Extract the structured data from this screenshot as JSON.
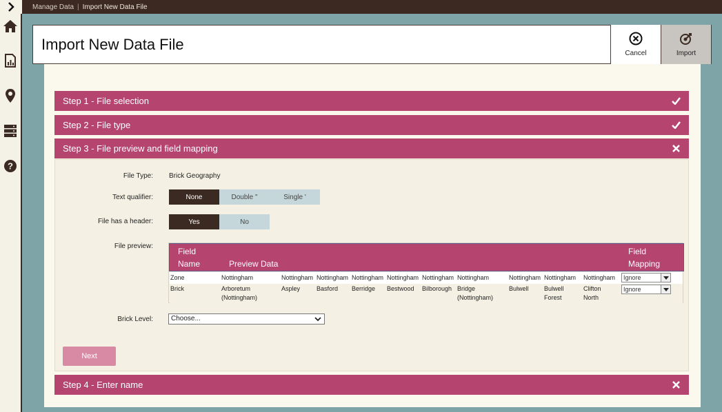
{
  "breadcrumb": {
    "parent": "Manage Data",
    "separator": "|",
    "current": "Import New Data File"
  },
  "header": {
    "title": "Import New Data File",
    "cancel_label": "Cancel",
    "import_label": "Import"
  },
  "rail": {
    "icons": [
      "home-icon",
      "report-icon",
      "map-pin-icon",
      "database-icon",
      "help-icon"
    ]
  },
  "steps": [
    {
      "label": "Step 1 - File selection",
      "state": "check"
    },
    {
      "label": "Step 2 - File type",
      "state": "check"
    },
    {
      "label": "Step 3 - File preview and field mapping",
      "state": "close"
    },
    {
      "label": "Step 4 - Enter name",
      "state": "close"
    }
  ],
  "step3": {
    "file_type_label": "File Type:",
    "file_type_value": "Brick Geography",
    "text_qualifier_label": "Text qualifier:",
    "text_qualifier_options": [
      "None",
      "Double \"",
      "Single '"
    ],
    "text_qualifier_selected": "None",
    "header_label": "File has a header:",
    "header_options": [
      "Yes",
      "No"
    ],
    "header_selected": "Yes",
    "preview_label": "File preview:",
    "preview": {
      "col_field": "Field",
      "col_name": "Name",
      "col_preview": "Preview Data",
      "col_mapping_1": "Field",
      "col_mapping_2": "Mapping",
      "rows": [
        {
          "name": "Zone",
          "cells": [
            "Nottingham",
            "Nottingham",
            "Nottingham",
            "Nottingham",
            "Nottingham",
            "Nottingham",
            "Nottingham",
            "Nottingham",
            "Nottingham",
            "Nottingham"
          ],
          "mapping": "Ignore"
        },
        {
          "name": "Brick",
          "cells": [
            "Arboretum (Nottingham)",
            "Aspley",
            "Basford",
            "Berridge",
            "Bestwood",
            "Bilborough",
            "Bridge (Nottingham)",
            "Bulwell",
            "Bulwell Forest",
            "Clifton North"
          ],
          "mapping": "Ignore"
        }
      ]
    },
    "brick_level_label": "Brick Level:",
    "brick_level_value": "Choose...",
    "next_label": "Next"
  },
  "colors": {
    "accent": "#b5446f",
    "dark": "#3c2a22",
    "teal": "#7fa4a8"
  }
}
